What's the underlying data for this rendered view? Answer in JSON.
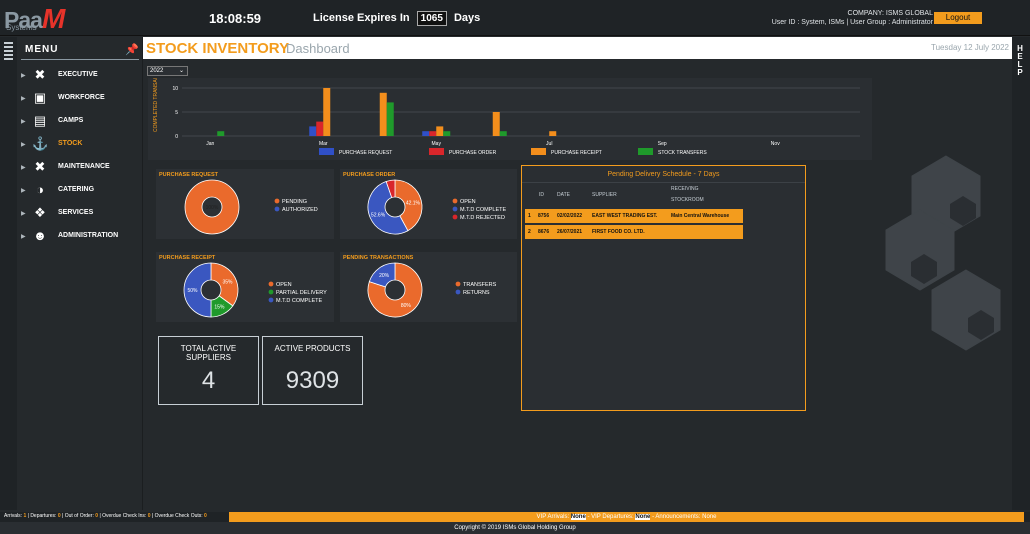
{
  "topbar": {
    "logo_main": "Paa",
    "logo_mark": "M",
    "logo_sub": "Systems",
    "clock": "18:08:59",
    "license_prefix": "License Expires In",
    "license_days": "1065",
    "license_suffix": "Days",
    "company": "COMPANY: ISMS GLOBAL",
    "user_line": "User ID : System, ISMs | User Group : Administrator",
    "logout_label": "Logout"
  },
  "sidebar": {
    "menu_label": "MENU",
    "items": [
      {
        "label": "EXECUTIVE",
        "icon": "tools-icon"
      },
      {
        "label": "WORKFORCE",
        "icon": "id-card-icon"
      },
      {
        "label": "CAMPS",
        "icon": "bed-icon"
      },
      {
        "label": "STOCK",
        "icon": "dolly-icon"
      },
      {
        "label": "MAINTENANCE",
        "icon": "wrench-icon"
      },
      {
        "label": "CATERING",
        "icon": "cloche-icon"
      },
      {
        "label": "SERVICES",
        "icon": "service-icon"
      },
      {
        "label": "ADMINISTRATION",
        "icon": "admin-user-icon"
      }
    ]
  },
  "right_rail": {
    "help_label": "HELP"
  },
  "header": {
    "title": "STOCK INVENTORY",
    "subtitle": "Dashboard",
    "date": "Tuesday 12 July 2022"
  },
  "year_select": {
    "value": "2022"
  },
  "chart_data": [
    {
      "type": "bar",
      "title": "",
      "ylabel": "COMPLETED TRANSACT...",
      "ylim": [
        0,
        10
      ],
      "yticks": [
        0,
        5,
        10
      ],
      "categories": [
        "Jan",
        "Feb",
        "Mar",
        "Apr",
        "May",
        "Jun",
        "Jul",
        "Aug",
        "Sep",
        "Oct",
        "Nov",
        "Dec"
      ],
      "xtick_labels": [
        "Jan",
        "",
        "Mar",
        "",
        "May",
        "",
        "Jul",
        "",
        "Sep",
        "",
        "Nov",
        ""
      ],
      "series": [
        {
          "name": "PURCHASE REQUEST",
          "color": "#3050c8",
          "values": [
            0,
            0,
            2,
            0,
            1,
            0,
            0,
            0,
            0,
            0,
            0,
            0
          ]
        },
        {
          "name": "PURCHASE ORDER",
          "color": "#d9262b",
          "values": [
            0,
            0,
            3,
            0,
            1,
            0,
            0,
            0,
            0,
            0,
            0,
            0
          ]
        },
        {
          "name": "PURCHASE RECEIPT",
          "color": "#f38e1c",
          "values": [
            0,
            0,
            10,
            9,
            2,
            5,
            1,
            0,
            0,
            0,
            0,
            0
          ]
        },
        {
          "name": "STOCK TRANSFERS",
          "color": "#1f9a2b",
          "values": [
            1,
            0,
            0,
            7,
            1,
            1,
            0,
            0,
            0,
            0,
            0,
            0
          ]
        }
      ]
    },
    {
      "type": "pie",
      "title": "PURCHASE REQUEST",
      "labels": [
        "PENDING",
        "AUTHORIZED"
      ],
      "values": [
        100,
        0
      ],
      "colors": [
        "#ea6a2c",
        "#3a57c0"
      ],
      "slice_labels": [
        "100%",
        ""
      ]
    },
    {
      "type": "pie",
      "title": "PURCHASE ORDER",
      "labels": [
        "OPEN",
        "M.T.D COMPLETE",
        "M.T.D REJECTED"
      ],
      "values": [
        42.1,
        52.6,
        5.3
      ],
      "colors": [
        "#ea6a2c",
        "#3a57c0",
        "#d9262b"
      ],
      "slice_labels": [
        "42.1%",
        "52.6%",
        ""
      ]
    },
    {
      "type": "pie",
      "title": "PURCHASE RECEIPT",
      "labels": [
        "OPEN",
        "PARTIAL DELIVERY",
        "M.T.D COMPLETE"
      ],
      "values": [
        35,
        15,
        50
      ],
      "colors": [
        "#ea6a2c",
        "#1f9a2b",
        "#3a57c0"
      ],
      "slice_labels": [
        "35%",
        "15%",
        "50%"
      ]
    },
    {
      "type": "pie",
      "title": "PENDING TRANSACTIONS",
      "labels": [
        "TRANSFERS",
        "RETURNS"
      ],
      "values": [
        80,
        20
      ],
      "colors": [
        "#ea6a2c",
        "#3a57c0"
      ],
      "slice_labels": [
        "80%",
        "20%"
      ]
    }
  ],
  "stats": {
    "suppliers_label": "TOTAL ACTIVE SUPPLIERS",
    "suppliers_value": "4",
    "products_label": "ACTIVE PRODUCTS",
    "products_value": "9309"
  },
  "pending": {
    "title": "Pending Delivery Schedule - 7 Days",
    "headers": [
      "ID",
      "DATE",
      "SUPPLIER",
      "RECEIVING",
      "STOCKROOM"
    ],
    "rows": [
      {
        "n": "1",
        "id": "8756",
        "date": "02/02/2022",
        "supplier": "EAST WEST TRADING EST.",
        "stockroom": "Main Central Warehouse"
      },
      {
        "n": "2",
        "id": "8676",
        "date": "26/07/2021",
        "supplier": "FIRST FOOD CO. LTD.",
        "stockroom": ""
      }
    ]
  },
  "footer": {
    "arrivals_label": "Arrivals:",
    "arrivals": "1",
    "departures_label": "| Departures:",
    "departures": "0",
    "ooo_label": "| Out of Order:",
    "ooo": "0",
    "ocin_label": "| Overdue Check Ins:",
    "ocin": "0",
    "ocout_label": "| Overdue Check Outs:",
    "ocout": "0",
    "vip_arr_label": "VIP Arrivals:",
    "vip_arr": "None",
    "vip_dep_label": "- VIP Departures:",
    "vip_dep": "None",
    "ann_label": "- Announcements:",
    "ann": "None",
    "copyright": "Copyright © 2019 ISMs Global Holding Group"
  }
}
